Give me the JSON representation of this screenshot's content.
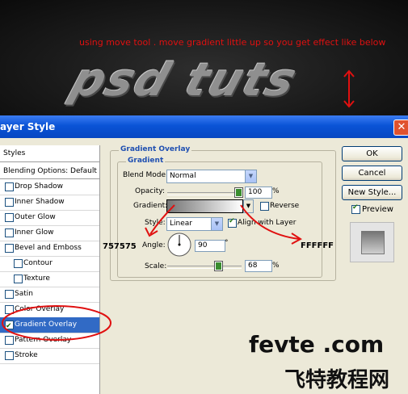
{
  "banner": {
    "instruction": "using move tool . move gradient little up so you get effect like below",
    "logo_text": "psd tuts"
  },
  "window": {
    "title": "ayer Style",
    "close_label": "✕"
  },
  "styles_panel": {
    "header": "Styles",
    "blending_options": "Blending Options: Default",
    "items": [
      {
        "label": "Drop Shadow",
        "checked": false
      },
      {
        "label": "Inner Shadow",
        "checked": false
      },
      {
        "label": "Outer Glow",
        "checked": false
      },
      {
        "label": "Inner Glow",
        "checked": false
      },
      {
        "label": "Bevel and Emboss",
        "checked": false
      },
      {
        "label": "Contour",
        "checked": false
      },
      {
        "label": "Texture",
        "checked": false
      },
      {
        "label": "Satin",
        "checked": false
      },
      {
        "label": "Color Overlay",
        "checked": false
      },
      {
        "label": "Gradient Overlay",
        "checked": true,
        "selected": true
      },
      {
        "label": "Pattern Overlay",
        "checked": false
      },
      {
        "label": "Stroke",
        "checked": false
      }
    ]
  },
  "gradient_overlay": {
    "section_title": "Gradient Overlay",
    "group_title": "Gradient",
    "blend_mode_label": "Blend Mode:",
    "blend_mode_value": "Normal",
    "opacity_label": "Opacity:",
    "opacity_value": "100",
    "opacity_unit": "%",
    "opacity_level": 1.0,
    "gradient_label": "Gradient:",
    "reverse_label": "Reverse",
    "reverse_checked": false,
    "style_label": "Style:",
    "style_value": "Linear",
    "align_label": "Align with Layer",
    "align_checked": true,
    "angle_label": "Angle:",
    "angle_value": "90",
    "angle_unit": "°",
    "scale_label": "Scale:",
    "scale_value": "68",
    "scale_unit": "%",
    "scale_level": 0.68
  },
  "buttons": {
    "ok": "OK",
    "cancel": "Cancel",
    "new_style": "New Style...",
    "preview_label": "Preview",
    "preview_checked": true
  },
  "annotations": {
    "left_color": "757575",
    "right_color": "FFFFFF"
  },
  "watermark": {
    "line1": "fevte .com",
    "line2": "飞特教程网"
  },
  "colors": {
    "annotation_red": "#e01010",
    "selection_blue": "#316ac5",
    "gradient_start": "#757575",
    "gradient_end": "#ffffff"
  }
}
